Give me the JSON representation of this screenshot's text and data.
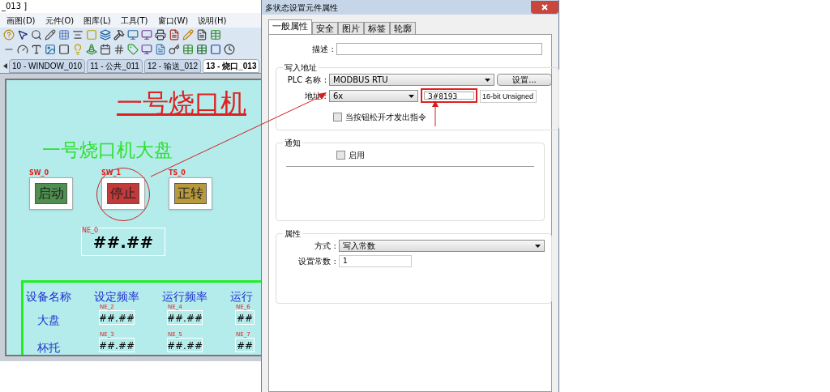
{
  "editor": {
    "title": "_013 ]",
    "menu": [
      "画图(D)",
      "元件(O)",
      "图库(L)",
      "工具(T)",
      "窗口(W)",
      "说明(H)"
    ],
    "tabs": [
      {
        "label": "10 - WINDOW_010",
        "selected": false
      },
      {
        "label": "11 - 公共_011",
        "selected": false
      },
      {
        "label": "12 - 输送_012",
        "selected": false
      },
      {
        "label": "13 - 烧口_013",
        "selected": true
      }
    ],
    "canvas": {
      "title": "一号烧口机",
      "subtitle": "一号烧口机大盘",
      "buttons": [
        {
          "tag": "SW_0",
          "label": "启动",
          "color": "#4f8f4f",
          "circled": false
        },
        {
          "tag": "SW_1",
          "label": "停止",
          "color": "#c23a3a",
          "circled": true
        },
        {
          "tag": "TS_0",
          "label": "正转",
          "color": "#b89a3e",
          "circled": false
        }
      ],
      "display": {
        "tag": "NE_0",
        "value": "##.##"
      },
      "table": {
        "columns": [
          "设备名称",
          "设定频率",
          "运行频率",
          "运行"
        ],
        "rows": [
          {
            "cells": [
              {
                "kind": "label",
                "value": "大盘"
              },
              {
                "kind": "numeric",
                "tag": "NE_2",
                "value": "##.##"
              },
              {
                "kind": "numeric",
                "tag": "NE_4",
                "value": "##.##"
              },
              {
                "kind": "numeric",
                "tag": "NE_6",
                "value": "##"
              }
            ]
          },
          {
            "cells": [
              {
                "kind": "label",
                "value": "杯托"
              },
              {
                "kind": "numeric",
                "tag": "NE_3",
                "value": "##.##"
              },
              {
                "kind": "numeric",
                "tag": "NE_5",
                "value": "##.##"
              },
              {
                "kind": "numeric",
                "tag": "NE_7",
                "value": "##"
              }
            ]
          }
        ]
      }
    }
  },
  "dialog": {
    "title": "多状态设置元件属性",
    "tabs": [
      {
        "label": "一般属性",
        "selected": true
      },
      {
        "label": "安全",
        "selected": false
      },
      {
        "label": "图片",
        "selected": false
      },
      {
        "label": "标签",
        "selected": false
      },
      {
        "label": "轮廓",
        "selected": false
      }
    ],
    "description_label": "描述 :",
    "write_address": {
      "legend": "写入地址",
      "plc_label": "PLC 名称 :",
      "plc_value": "MODBUS RTU",
      "settings_button": "设置...",
      "address_label": "地址 :",
      "address_type": "6x",
      "address_value": "3#8193",
      "address_highlighted": true,
      "data_type": "16-bit Unsigned",
      "release_checkbox": {
        "label": "当按钮松开才发出指令",
        "checked": false
      }
    },
    "notify": {
      "legend": "通知",
      "enable_checkbox": {
        "label": "启用",
        "checked": false
      }
    },
    "properties": {
      "legend": "属性",
      "mode_label": "方式 :",
      "mode_value": "写入常数",
      "constant_label": "设置常数 :",
      "constant_value": "1"
    }
  }
}
